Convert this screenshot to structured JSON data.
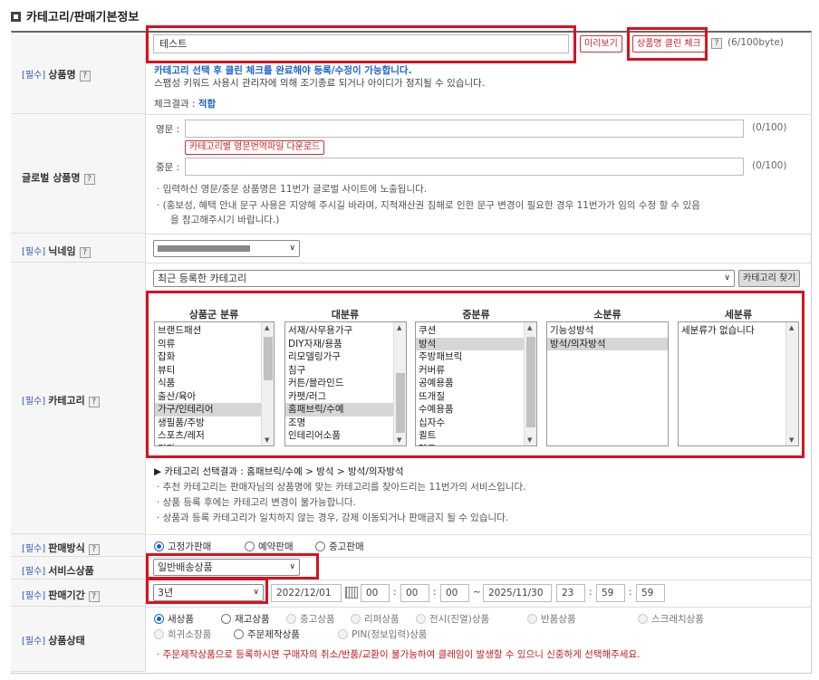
{
  "section_title": "카테고리/판매기본정보",
  "required_tag": "[필수]",
  "help_mark": "?",
  "product_name": {
    "label": "상품명",
    "value": "테스트",
    "preview_btn": "미리보기",
    "clean_check_btn": "상품명 클린 체크",
    "byte_count": "(6/100byte)",
    "warning": "카테고리 선택 후 클린 체크를 완료해야 등록/수정이 가능합니다.",
    "spam_notice": "스팸성 키워드 사용시 관리자에 의해 조기종료 되거나 아이디가 정지될 수 있습니다.",
    "check_result_label": "체크결과 : ",
    "check_result_value": "적합"
  },
  "global_name": {
    "label": "글로벌 상품명",
    "english_label": "영문 :",
    "english_count": "(0/100)",
    "download_btn": "카테고리별 영문번역파일 다운로드",
    "chinese_label": "중문 :",
    "chinese_count": "(0/100)",
    "note1": "· 입력하신 영문/중문 상품명은 11번가 글로벌 사이트에 노출됩니다.",
    "note2a": "· (홍보성, 혜택 안내 문구 사용은 지양해 주시길 바라며, 지적재산권 침해로 인한 문구 변경이 필요한 경우 11번가가 임의 수정 할 수 있음",
    "note2b": "을 참고해주시기 바랍니다.)"
  },
  "nickname": {
    "label": "닉네임"
  },
  "category": {
    "label": "카테고리",
    "recent_select": "최근 등록한 카테고리",
    "find_btn": "카테고리 찾기",
    "headers": [
      "상품군 분류",
      "대분류",
      "중분류",
      "소분류",
      "세분류"
    ],
    "col1": [
      "브랜드패션",
      "의류",
      "잡화",
      "뷰티",
      "식품",
      "출산/육아",
      "가구/인테리어",
      "생필품/주방",
      "스포츠/레저",
      "건강"
    ],
    "col1_selected": 6,
    "col2": [
      "서재/사무용가구",
      "DIY자재/용품",
      "리모델링가구",
      "침구",
      "커튼/블라인드",
      "카펫/러그",
      "홈패브릭/수예",
      "조명",
      "인테리어소품"
    ],
    "col2_selected": 6,
    "col3": [
      "쿠션",
      "방석",
      "주방패브릭",
      "커버류",
      "공예용품",
      "뜨개질",
      "수예용품",
      "십자수",
      "퀼트",
      "펠트"
    ],
    "col3_selected": 1,
    "col4": [
      "기능성방석",
      "방석/의자방석"
    ],
    "col4_selected": 1,
    "col5": [
      "세분류가 없습니다"
    ],
    "result_prefix": "▶ 카테고리 선택결과 : ",
    "result_path": "홈패브릭/수예 > 방석 > 방석/의자방석",
    "note1": "· 추천 카테고리는 판매자님의 상품명에 맞는 카테고리를 찾아드리는 11번가의 서비스입니다.",
    "note2": "· 상품 등록 후에는 카테고리 변경이 불가능합니다.",
    "note3": "· 상품과 등록 카테고리가 일치하지 않는 경우, 강제 이동되거나 판매금지 될 수 있습니다."
  },
  "sales_method": {
    "label": "판매방식",
    "options": [
      "고정가판매",
      "예약판매",
      "중고판매"
    ],
    "selected": 0
  },
  "service_product": {
    "label": "서비스상품",
    "value": "일반배송상품"
  },
  "sales_period": {
    "label": "판매기간",
    "period": "3년",
    "start_date": "2022/12/01",
    "start_h": "00",
    "start_m": "00",
    "start_s": "00",
    "tilde": "~",
    "end_date": "2025/11/30",
    "end_h": "23",
    "end_m": "59",
    "end_s": "59",
    "colon": ":"
  },
  "product_status": {
    "label": "상품상태",
    "row1": [
      "새상품",
      "재고상품",
      "중고상품",
      "리퍼상품",
      "전시(진열)상품",
      "반품상품",
      "스크래치상품"
    ],
    "row2": [
      "희귀소장품",
      "주문제작상품",
      "PIN(정보입력)상품"
    ],
    "selected": "새상품",
    "warning": "· 주문제작상품으로 등록하시면 구매자의 취소/반품/교환이 불가능하여 클레임이 발생할 수 있으니 신중하게 선택해주세요."
  },
  "colors": {
    "accent_red": "#d8111f",
    "link_blue": "#1a63c7"
  }
}
